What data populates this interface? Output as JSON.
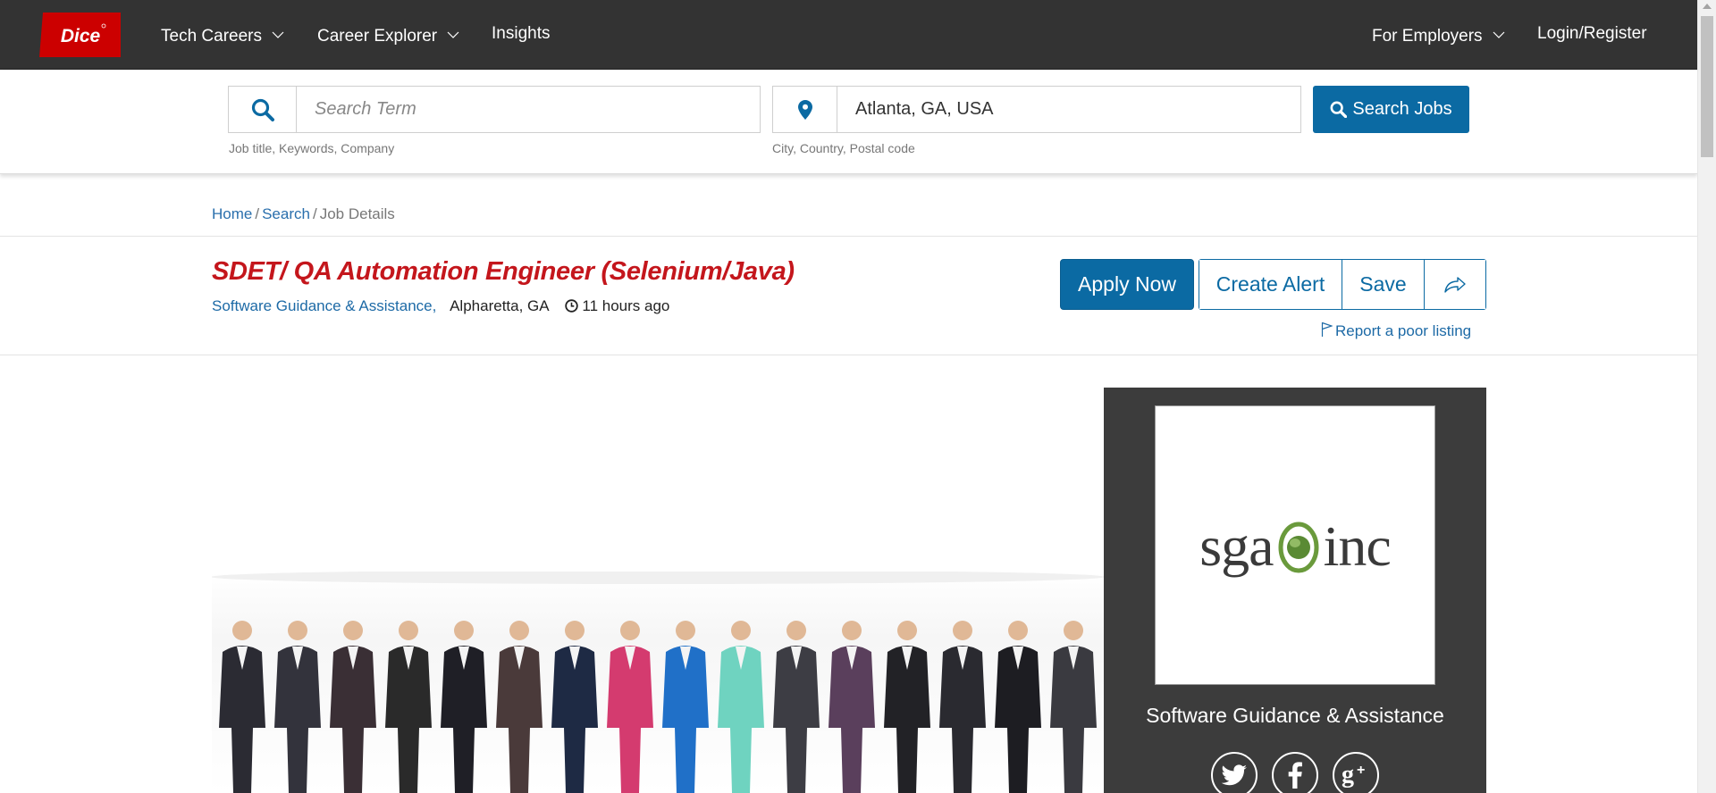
{
  "nav": {
    "logo_text": "Dice",
    "items": [
      {
        "label": "Tech Careers",
        "has_dropdown": true
      },
      {
        "label": "Career Explorer",
        "has_dropdown": true
      },
      {
        "label": "Insights",
        "has_dropdown": false
      },
      {
        "label": "For Employers",
        "has_dropdown": true
      },
      {
        "label": "Login/Register",
        "has_dropdown": false
      }
    ]
  },
  "search": {
    "keyword_placeholder": "Search Term",
    "keyword_value": "",
    "keyword_help": "Job title, Keywords, Company",
    "location_value": "Atlanta, GA, USA",
    "location_help": "City, Country, Postal code",
    "button_label": "Search Jobs",
    "search_icon": "search-icon",
    "location_icon": "map-marker-icon"
  },
  "breadcrumb": {
    "home": "Home",
    "search": "Search",
    "current": "Job Details",
    "separator": "/"
  },
  "job": {
    "title": "SDET/ QA Automation Engineer (Selenium/Java)",
    "company": "Software Guidance & Assistance,",
    "location": "Alpharetta, GA",
    "posted": "11 hours ago"
  },
  "actions": {
    "apply": "Apply Now",
    "create_alert": "Create Alert",
    "save": "Save",
    "share_icon": "share-icon",
    "report": "Report a poor listing"
  },
  "company_card": {
    "logo_left": "sga",
    "logo_right": "inc",
    "name": "Software Guidance & Assistance",
    "socials": [
      "twitter-icon",
      "facebook-icon",
      "google-plus-icon"
    ]
  },
  "colors": {
    "nav_bg": "#333333",
    "brand_red": "#cc0000",
    "primary_blue": "#0b6aa3",
    "title_red": "#c4161c",
    "card_bg": "#3c3c3c"
  }
}
